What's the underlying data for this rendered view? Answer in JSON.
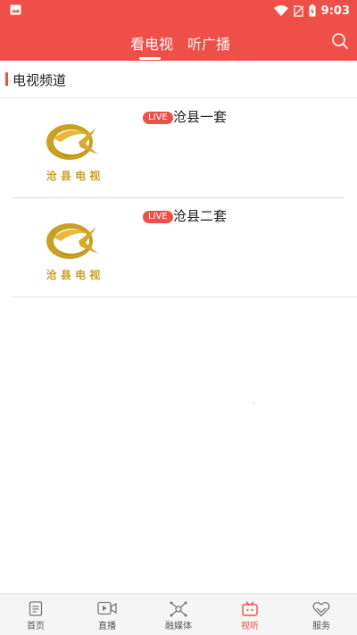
{
  "status_bar": {
    "time": "9:03",
    "icons": [
      "gallery-icon",
      "wifi-icon",
      "no-sim-icon",
      "battery-charging-icon"
    ]
  },
  "header": {
    "tabs": [
      {
        "label": "看电视",
        "active": true
      },
      {
        "label": "听广播",
        "active": false
      }
    ],
    "search_icon": "search-icon"
  },
  "section": {
    "title": "电视频道"
  },
  "channels": [
    {
      "name": "沧县一套",
      "badge": "LIVE",
      "logo_text": "沧 县 电 视"
    },
    {
      "name": "沧县二套",
      "badge": "LIVE",
      "logo_text": "沧 县 电 视"
    }
  ],
  "bottom_nav": {
    "items": [
      {
        "label": "首页",
        "icon": "home-doc-icon",
        "active": false
      },
      {
        "label": "直播",
        "icon": "video-icon",
        "active": false
      },
      {
        "label": "融媒体",
        "icon": "media-icon",
        "active": false
      },
      {
        "label": "视听",
        "icon": "tv-icon",
        "active": true
      },
      {
        "label": "服务",
        "icon": "service-heart-icon",
        "active": false
      }
    ]
  },
  "colors": {
    "accent": "#ef4f49",
    "logo_gold": "#c9a022"
  }
}
